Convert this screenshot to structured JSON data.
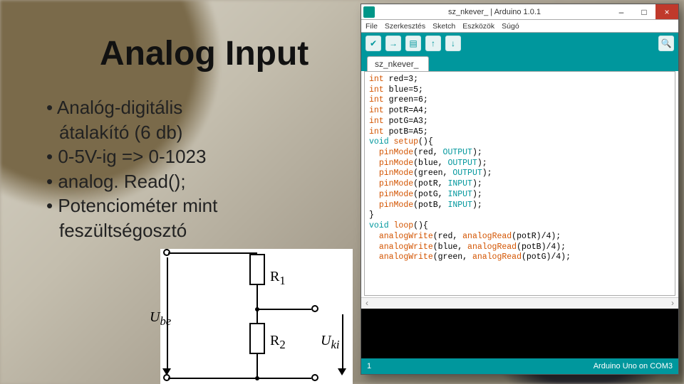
{
  "slide": {
    "title": "Analog Input",
    "bullets": {
      "b1a": "• Analóg-digitális",
      "b1b": "átalakító (6 db)",
      "b2": "• 0-5V-ig => 0-1023",
      "b3": "• analog. Read();",
      "b4a": "• Potenciométer mint",
      "b4b": "feszültségosztó"
    },
    "divider": {
      "Ube": "U",
      "Ube_sub": "be",
      "Uki": "U",
      "Uki_sub": "ki",
      "R1": "R",
      "R1_sub": "1",
      "R2": "R",
      "R2_sub": "2"
    }
  },
  "ide": {
    "window_title": "sz_nkever_ | Arduino 1.0.1",
    "icons": {
      "app": "arduino-icon",
      "min": "–",
      "max": "□",
      "close": "×"
    },
    "menubar": [
      "File",
      "Szerkesztés",
      "Sketch",
      "Eszközök",
      "Súgó"
    ],
    "toolbar": {
      "verify": "✔",
      "upload": "→",
      "new": "▤",
      "open": "↑",
      "save": "↓",
      "serial": "🔍"
    },
    "tab": "sz_nkever_",
    "code": {
      "l01": "int red=3;",
      "l02": "int blue=5;",
      "l03": "int green=6;",
      "l04": "int potR=A4;",
      "l05": "int potG=A3;",
      "l06": "int potB=A5;",
      "l07": "void setup(){",
      "l08": "  pinMode(red, OUTPUT);",
      "l09": "  pinMode(blue, OUTPUT);",
      "l10": "  pinMode(green, OUTPUT);",
      "l11": "  pinMode(potR, INPUT);",
      "l12": "  pinMode(potG, INPUT);",
      "l13": "  pinMode(potB, INPUT);",
      "l14": "}",
      "l15": "void loop(){",
      "l16": "  analogWrite(red, analogRead(potR)/4);",
      "l17": "  analogWrite(blue, analogRead(potB)/4);",
      "l18": "  analogWrite(green, analogRead(potG)/4);"
    },
    "scroll_left": "‹",
    "scroll_right": "›",
    "status_left": "1",
    "status_right": "Arduino Uno on COM3"
  }
}
